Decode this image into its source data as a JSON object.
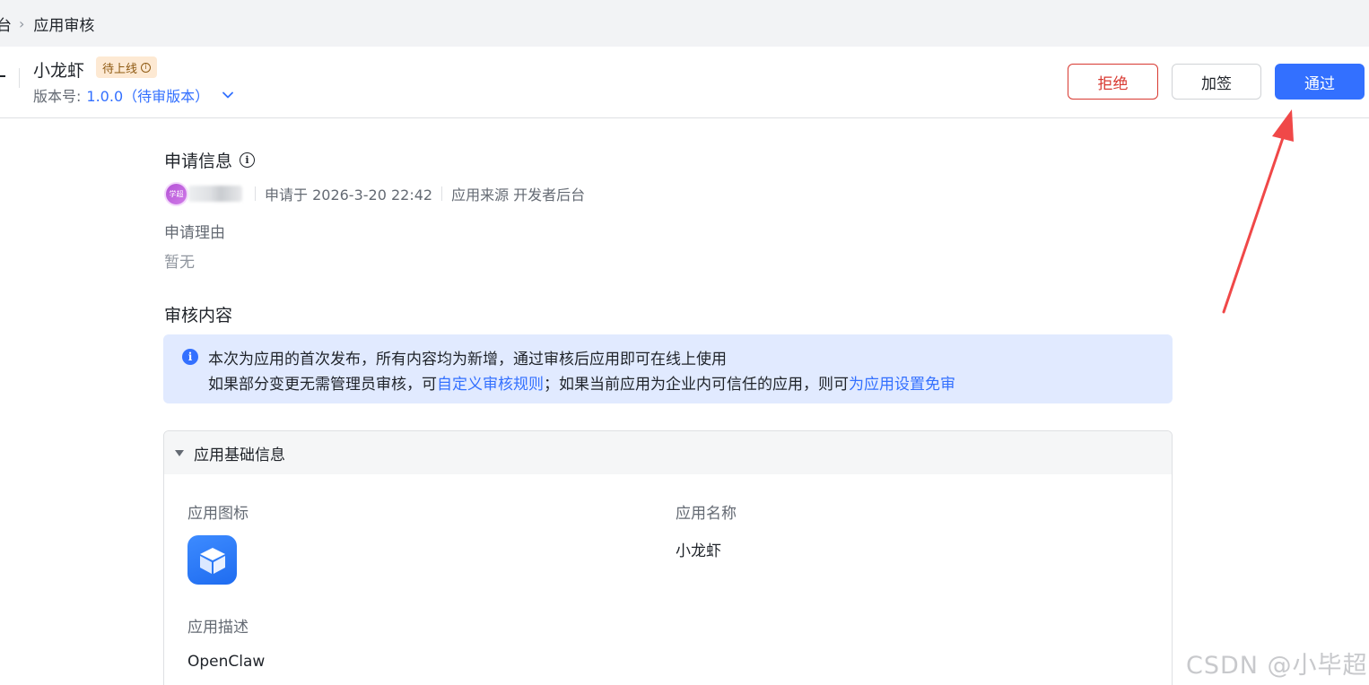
{
  "breadcrumb": {
    "prev": "台",
    "current": "应用审核"
  },
  "header": {
    "app_name": "小龙虾",
    "status": "待上线",
    "version_label": "版本号:",
    "version_value": "1.0.0（待审版本）"
  },
  "actions": {
    "reject": "拒绝",
    "countersign": "加签",
    "approve": "通过"
  },
  "application_info": {
    "title": "申请信息",
    "avatar_text": "学超",
    "applied_at": "申请于 2026-3-20 22:42",
    "source": "应用来源 开发者后台",
    "reason_label": "申请理由",
    "reason_value": "暂无"
  },
  "review_content": {
    "title": "审核内容",
    "notice_line1": "本次为应用的首次发布，所有内容均为新增，通过审核后应用即可在线上使用",
    "notice_line2_a": "如果部分变更无需管理员审核，可",
    "notice_link1": "自定义审核规则",
    "notice_line2_b": "；如果当前应用为企业内可信任的应用，则可",
    "notice_link2": "为应用设置免审"
  },
  "basic_info": {
    "title": "应用基础信息",
    "icon_label": "应用图标",
    "name_label": "应用名称",
    "name_value": "小龙虾",
    "desc_label": "应用描述",
    "desc_value": "OpenClaw"
  },
  "watermark": "CSDN @小毕超",
  "colors": {
    "primary": "#3370ff",
    "danger": "#d83931",
    "notice_bg": "#e1eaff",
    "tag_bg": "#fde9d3",
    "annotation_arrow": "#f04848"
  }
}
